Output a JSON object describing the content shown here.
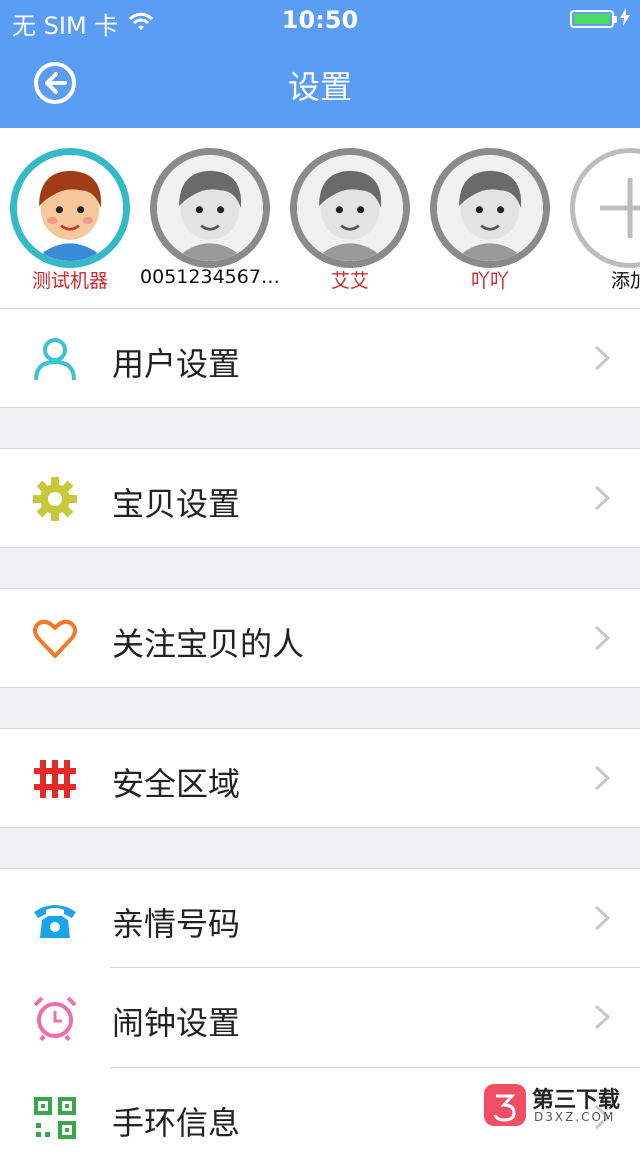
{
  "status_bar": {
    "carrier": "无 SIM 卡",
    "time": "10:50"
  },
  "nav": {
    "title": "设置"
  },
  "avatars": [
    {
      "name": "测试机器",
      "selected": true
    },
    {
      "name": "0051234567…",
      "selected": false
    },
    {
      "name": "艾艾",
      "selected": false
    },
    {
      "name": "吖吖",
      "selected": false
    },
    {
      "name": "添加",
      "type": "add"
    }
  ],
  "menu": [
    {
      "label": "用户设置",
      "icon": "user-icon",
      "color": "#3cc3d0"
    },
    {
      "label": "宝贝设置",
      "icon": "gear-icon",
      "color": "#c8c83a"
    },
    {
      "label": "关注宝贝的人",
      "icon": "heart-icon",
      "color": "#f07a2a"
    },
    {
      "label": "安全区域",
      "icon": "fence-icon",
      "color": "#e52a2a"
    },
    {
      "label": "亲情号码",
      "icon": "phone-icon",
      "color": "#1aa6e6"
    },
    {
      "label": "闹钟设置",
      "icon": "alarm-clock-icon",
      "color": "#ee6fb0"
    },
    {
      "label": "手环信息",
      "icon": "qr-code-icon",
      "color": "#3aa64a"
    }
  ],
  "watermark": {
    "title": "第三下载",
    "subtitle": "D3XZ.COM"
  }
}
